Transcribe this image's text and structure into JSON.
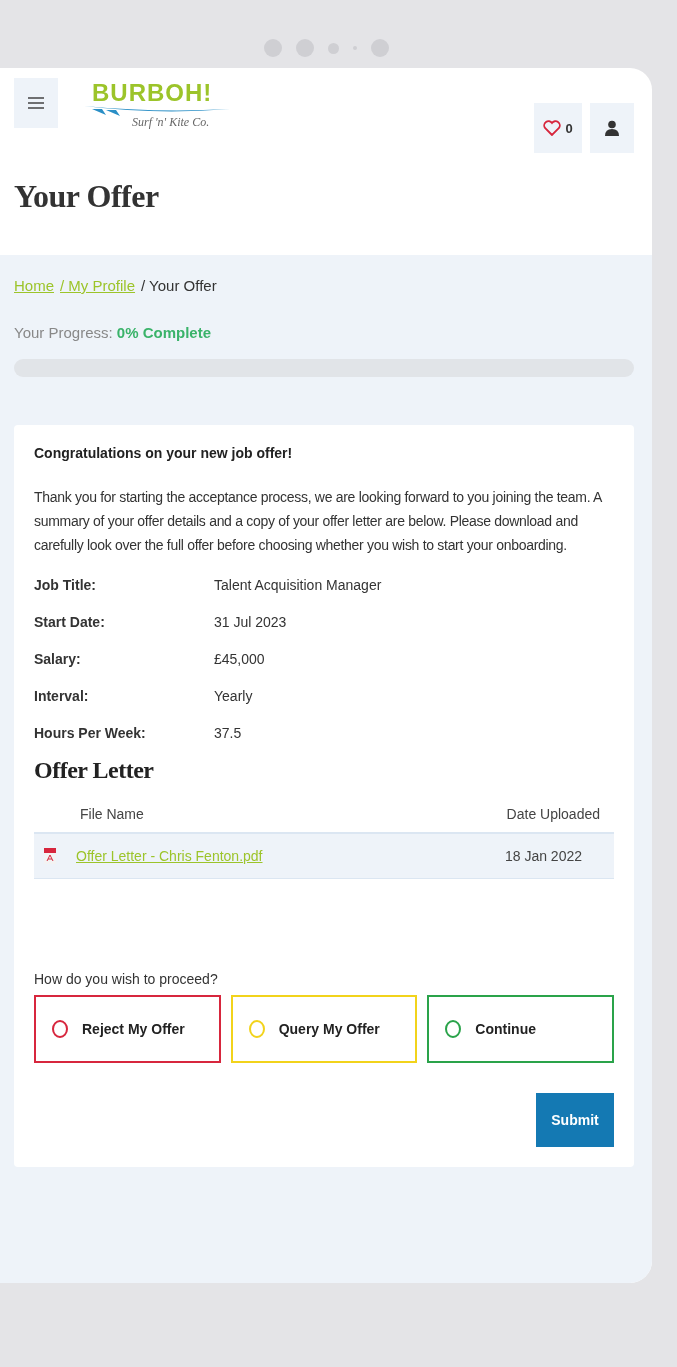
{
  "header": {
    "logo": {
      "name": "BURBOH!",
      "tagline": "Surf 'n' Kite Co."
    },
    "favourites_count": "0"
  },
  "page_title": "Your Offer",
  "breadcrumb": [
    {
      "label": "Home",
      "kind": "link"
    },
    {
      "label": "/ My Profile",
      "kind": "link"
    },
    {
      "label": "/ Your Offer",
      "kind": "current"
    }
  ],
  "progress": {
    "label": "Your Progress:",
    "value": "0% Complete",
    "level": 0
  },
  "card": {
    "heading": "Congratulations on your new job offer!",
    "intro": "Thank you for starting the acceptance process, we are looking forward to you joining the team. A summary of your offer details and a copy of your offer letter are below. Please download and carefully look over the full offer before choosing whether you wish to start your onboarding.",
    "details": [
      {
        "label": "Job Title:",
        "value": "Talent Acquisition Manager"
      },
      {
        "label": "Start Date:",
        "value": "31 Jul 2023"
      },
      {
        "label": "Salary:",
        "value": "£45,000"
      },
      {
        "label": "Interval:",
        "value": "Yearly"
      },
      {
        "label": "Hours Per Week:",
        "value": "37.5"
      }
    ],
    "letter_heading": "Offer Letter",
    "table": {
      "columns": [
        "File Name",
        "Date Uploaded"
      ],
      "rows": [
        {
          "file": "Offer Letter - Chris Fenton.pdf",
          "date": "18 Jan 2022"
        }
      ]
    },
    "question": "How do you wish to proceed?",
    "options": [
      {
        "label": "Reject My Offer",
        "color": "#d7263d",
        "selected": false
      },
      {
        "label": "Query My Offer",
        "color": "#f2d31b",
        "selected": false
      },
      {
        "label": "Continue",
        "color": "#2aa34a",
        "selected": false
      }
    ],
    "submit": "Submit"
  }
}
